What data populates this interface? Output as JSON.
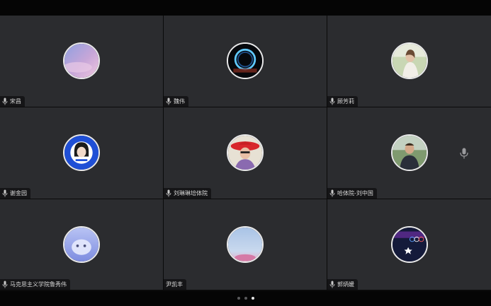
{
  "participants": [
    {
      "name": "宋昌"
    },
    {
      "name": "魏伟"
    },
    {
      "name": "顾芳莉"
    },
    {
      "name": "谢金园"
    },
    {
      "name": "刘琳琳培体院"
    },
    {
      "name": "哈体院-刘中国"
    },
    {
      "name": "马克思主义学院鲁秀伟"
    },
    {
      "name": "尹凯丰"
    },
    {
      "name": "郭炳媛"
    }
  ],
  "pager": {
    "pages": 3,
    "active_page": 3
  },
  "colors": {
    "tile_bg": "#2b2c2f",
    "nametag_bg": "#141416",
    "mic_color": "#c9c9c9",
    "dot_active": "#e6e6e6",
    "dot_inactive": "#5a5a5c"
  }
}
